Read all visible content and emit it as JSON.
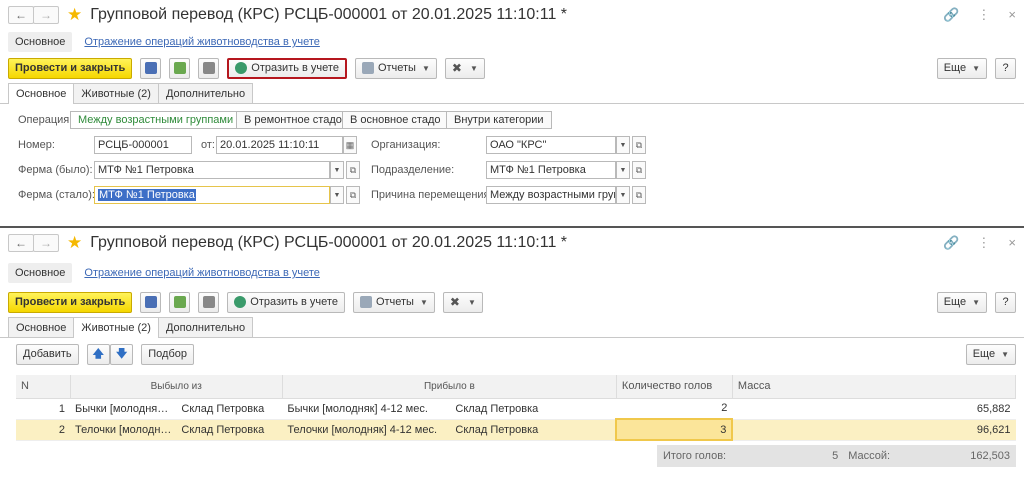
{
  "window": {
    "title": "Групповой перевод (КРС) РСЦБ-000001 от 20.01.2025 11:10:11 *",
    "back_glyph": "←",
    "fwd_glyph": "→",
    "star_glyph": "★",
    "link_glyph": "🔗",
    "menu_glyph": "⋮",
    "close_glyph": "×"
  },
  "nav": {
    "main": "Основное",
    "link": "Отражение операций животноводства в учете"
  },
  "toolbar": {
    "post_close": "Провести и закрыть",
    "reflect": "Отразить в учете",
    "reports": "Отчеты",
    "more": "Еще",
    "help": "?"
  },
  "tabs": [
    "Основное",
    "Животные (2)",
    "Дополнительно"
  ],
  "form": {
    "operation_label": "Операция:",
    "operations": [
      "Между возрастными группами",
      "В ремонтное стадо",
      "В основное стадо",
      "Внутри категории"
    ],
    "number_label": "Номер:",
    "number": "РСЦБ-000001",
    "date_label": "от:",
    "date": "20.01.2025 11:10:11",
    "org_label": "Организация:",
    "org": "ОАО \"КРС\"",
    "farm_from_label": "Ферма (было):",
    "farm_from": "МТФ №1 Петровка",
    "division_label": "Подразделение:",
    "division": "МТФ №1 Петровка",
    "farm_to_label": "Ферма (стало):",
    "farm_to": "МТФ №1 Петровка",
    "reason_label": "Причина перемещения:",
    "reason": "Между возрастными груг"
  },
  "animals": {
    "add": "Добавить",
    "pick": "Подбор",
    "more": "Еще",
    "columns": {
      "n": "N",
      "from": "Выбыло из",
      "to": "Прибыло в",
      "count": "Количество голов",
      "mass": "Масса"
    },
    "rows": [
      {
        "n": "1",
        "group_from": "Бычки [молодня…",
        "warehouse_from": "Склад Петровка",
        "group_to": "Бычки [молодняк] 4-12 мес.",
        "warehouse_to": "Склад Петровка",
        "count": "2",
        "mass": "65,882"
      },
      {
        "n": "2",
        "group_from": "Телочки [молодн…",
        "warehouse_from": "Склад Петровка",
        "group_to": "Телочки [молодняк] 4-12 мес.",
        "warehouse_to": "Склад Петровка",
        "count": "3",
        "mass": "96,621"
      }
    ],
    "total_label": "Итого голов:",
    "total_count": "5",
    "mass_label": "Массой:",
    "total_mass": "162,503"
  }
}
